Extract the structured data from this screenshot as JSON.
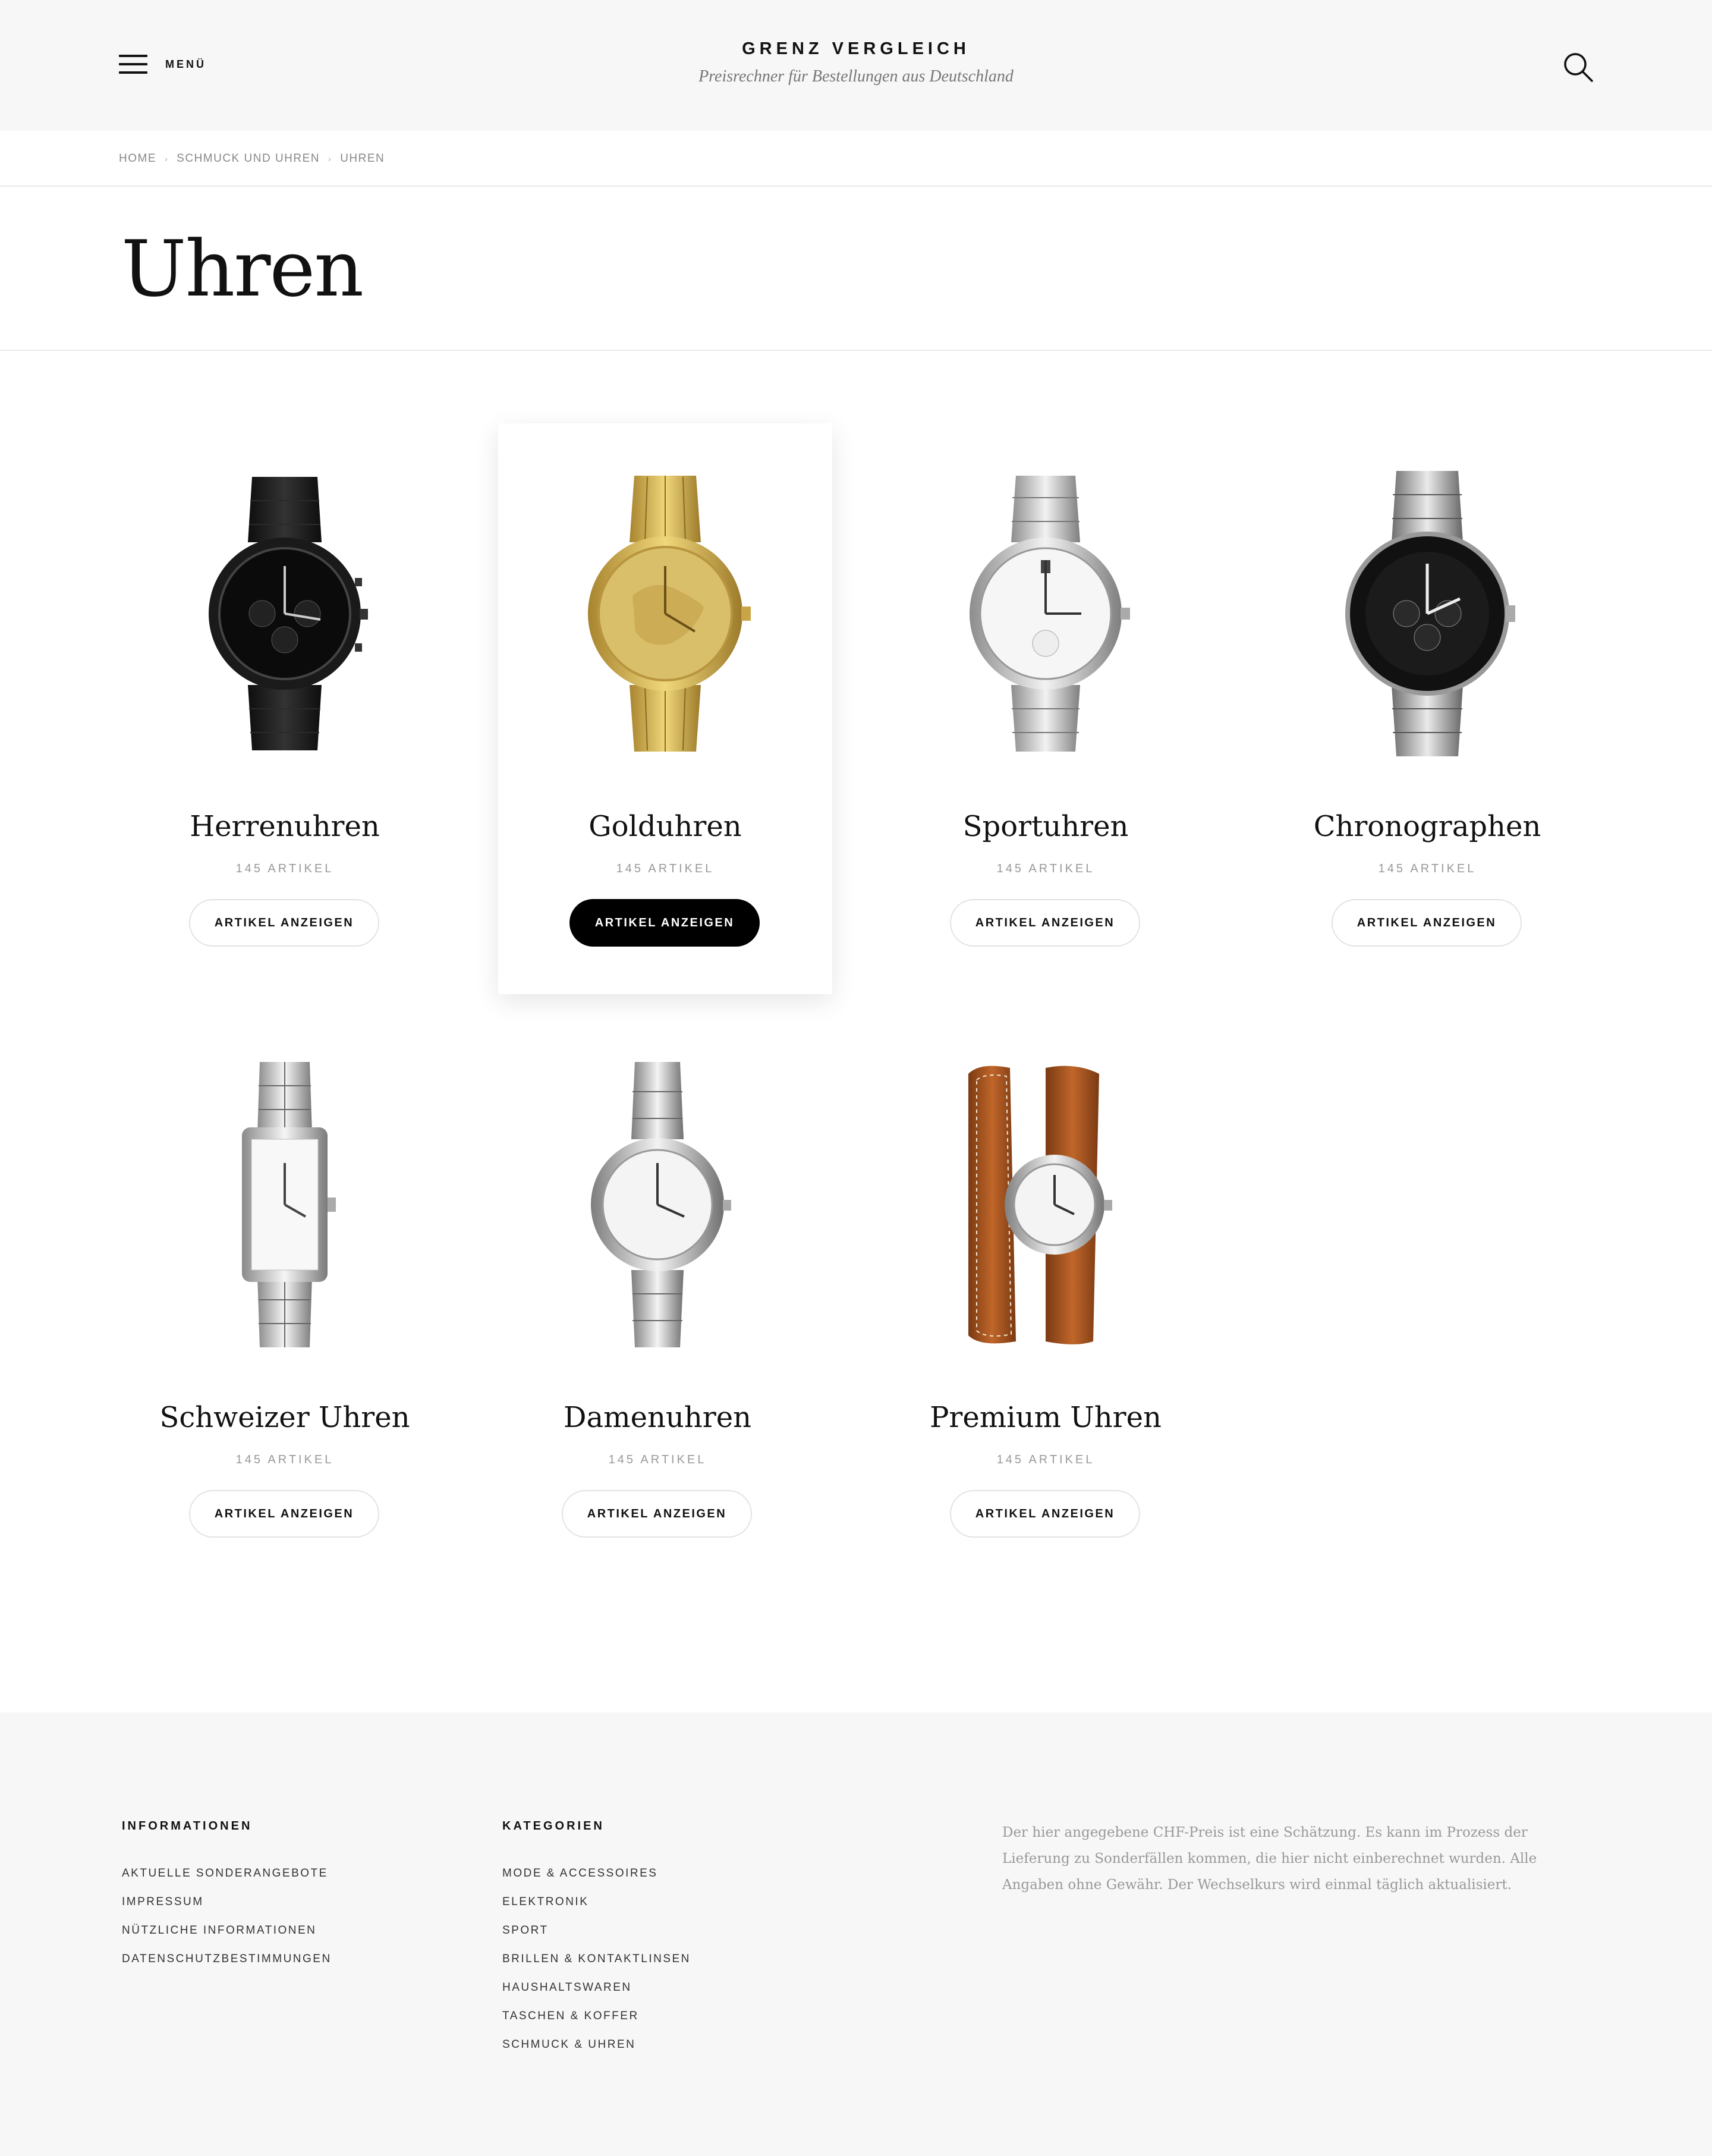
{
  "header": {
    "menu_label": "MENÜ",
    "brand_title": "GRENZ VERGLEICH",
    "brand_subtitle": "Preisrechner für Bestellungen aus Deutschland"
  },
  "breadcrumb": [
    "HOME",
    "SCHMUCK UND UHREN",
    "UHREN"
  ],
  "page_title": "Uhren",
  "products": [
    {
      "name": "Herrenuhren",
      "count": "145 ARTIKEL",
      "button": "ARTIKEL ANZEIGEN",
      "style": "black-rubber"
    },
    {
      "name": "Golduhren",
      "count": "145 ARTIKEL",
      "button": "ARTIKEL ANZEIGEN",
      "style": "gold",
      "highlighted": true
    },
    {
      "name": "Sportuhren",
      "count": "145 ARTIKEL",
      "button": "ARTIKEL ANZEIGEN",
      "style": "silver"
    },
    {
      "name": "Chronographen",
      "count": "145 ARTIKEL",
      "button": "ARTIKEL ANZEIGEN",
      "style": "chrono"
    },
    {
      "name": "Schweizer Uhren",
      "count": "145 ARTIKEL",
      "button": "ARTIKEL ANZEIGEN",
      "style": "rectangular"
    },
    {
      "name": "Damenuhren",
      "count": "145 ARTIKEL",
      "button": "ARTIKEL ANZEIGEN",
      "style": "ladies"
    },
    {
      "name": "Premium Uhren",
      "count": "145 ARTIKEL",
      "button": "ARTIKEL ANZEIGEN",
      "style": "leather-wrap"
    }
  ],
  "footer": {
    "info_title": "INFORMATIONEN",
    "info_links": [
      "AKTUELLE SONDERANGEBOTE",
      "IMPRESSUM",
      "NÜTZLICHE INFORMATIONEN",
      "DATENSCHUTZBESTIMMUNGEN"
    ],
    "cat_title": "KATEGORIEN",
    "cat_links": [
      "MODE & ACCESSOIRES",
      "ELEKTRONIK",
      "SPORT",
      "BRILLEN & KONTAKTLINSEN",
      "HAUSHALTSWAREN",
      "TASCHEN & KOFFER",
      "SCHMUCK & UHREN"
    ],
    "note": "Der hier angegebene CHF-Preis ist eine Schätzung. Es kann im Prozess der Lieferung zu Sonderfällen kommen, die hier nicht einberechnet wurden. Alle Angaben ohne Gewähr. Der Wechselkurs wird einmal täglich aktualisiert."
  },
  "colors": {
    "header_bg": "#f7f7f7",
    "footer_bg": "#f7f7f7",
    "primary_button": "#000000",
    "muted_text": "#999999"
  },
  "icons": {
    "menu": "hamburger-icon",
    "search": "search-icon",
    "breadcrumb_separator": "chevron-right-icon"
  }
}
